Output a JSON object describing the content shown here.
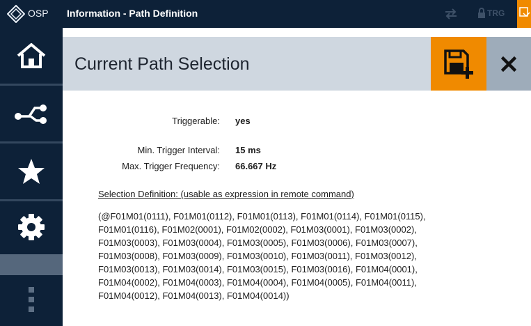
{
  "titlebar": {
    "brand": "OSP",
    "window_title": "Information - Path Definition",
    "trg_label": "TRG"
  },
  "sidebar": {
    "items": [
      {
        "name": "home",
        "icon": "home-icon"
      },
      {
        "name": "path",
        "icon": "path-icon"
      },
      {
        "name": "favorites",
        "icon": "star-icon"
      },
      {
        "name": "settings",
        "icon": "gear-icon"
      },
      {
        "name": "more",
        "icon": "more-dots-icon"
      }
    ]
  },
  "header": {
    "title": "Current Path Selection",
    "save_icon": "save-add-icon",
    "close_icon": "close-icon"
  },
  "info": {
    "triggerable_label": "Triggerable:",
    "triggerable_value": "yes",
    "min_interval_label": "Min. Trigger Interval:",
    "min_interval_value": "15 ms",
    "max_freq_label": "Max. Trigger Frequency:",
    "max_freq_value": "66.667 Hz"
  },
  "selection": {
    "heading": "Selection Definition: (usable as expression in remote command)",
    "lines": [
      "(@F01M01(0111), F01M01(0112), F01M01(0113), F01M01(0114), F01M01(0115),",
      "F01M01(0116), F01M02(0001), F01M02(0002), F01M03(0001), F01M03(0002),",
      "F01M03(0003), F01M03(0004), F01M03(0005), F01M03(0006), F01M03(0007),",
      "F01M03(0008), F01M03(0009), F01M03(0010), F01M03(0011), F01M03(0012),",
      "F01M03(0013), F01M03(0014), F01M03(0015), F01M03(0016), F01M04(0001),",
      "F01M04(0002), F01M04(0003), F01M04(0004), F01M04(0005), F01M04(0011),",
      "F01M04(0012), F01M04(0013), F01M04(0014))"
    ]
  },
  "colors": {
    "nav_bg": "#0d2138",
    "accent_orange": "#f08a00",
    "header_bg": "#cfd7e0",
    "close_bg": "#9eacba"
  }
}
